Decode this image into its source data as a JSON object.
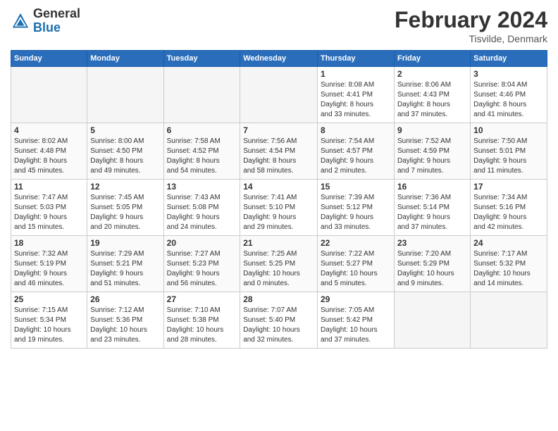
{
  "header": {
    "logo_general": "General",
    "logo_blue": "Blue",
    "month_title": "February 2024",
    "location": "Tisvilde, Denmark"
  },
  "weekdays": [
    "Sunday",
    "Monday",
    "Tuesday",
    "Wednesday",
    "Thursday",
    "Friday",
    "Saturday"
  ],
  "weeks": [
    {
      "days": [
        {
          "num": "",
          "info": ""
        },
        {
          "num": "",
          "info": ""
        },
        {
          "num": "",
          "info": ""
        },
        {
          "num": "",
          "info": ""
        },
        {
          "num": "1",
          "info": "Sunrise: 8:08 AM\nSunset: 4:41 PM\nDaylight: 8 hours\nand 33 minutes."
        },
        {
          "num": "2",
          "info": "Sunrise: 8:06 AM\nSunset: 4:43 PM\nDaylight: 8 hours\nand 37 minutes."
        },
        {
          "num": "3",
          "info": "Sunrise: 8:04 AM\nSunset: 4:46 PM\nDaylight: 8 hours\nand 41 minutes."
        }
      ]
    },
    {
      "days": [
        {
          "num": "4",
          "info": "Sunrise: 8:02 AM\nSunset: 4:48 PM\nDaylight: 8 hours\nand 45 minutes."
        },
        {
          "num": "5",
          "info": "Sunrise: 8:00 AM\nSunset: 4:50 PM\nDaylight: 8 hours\nand 49 minutes."
        },
        {
          "num": "6",
          "info": "Sunrise: 7:58 AM\nSunset: 4:52 PM\nDaylight: 8 hours\nand 54 minutes."
        },
        {
          "num": "7",
          "info": "Sunrise: 7:56 AM\nSunset: 4:54 PM\nDaylight: 8 hours\nand 58 minutes."
        },
        {
          "num": "8",
          "info": "Sunrise: 7:54 AM\nSunset: 4:57 PM\nDaylight: 9 hours\nand 2 minutes."
        },
        {
          "num": "9",
          "info": "Sunrise: 7:52 AM\nSunset: 4:59 PM\nDaylight: 9 hours\nand 7 minutes."
        },
        {
          "num": "10",
          "info": "Sunrise: 7:50 AM\nSunset: 5:01 PM\nDaylight: 9 hours\nand 11 minutes."
        }
      ]
    },
    {
      "days": [
        {
          "num": "11",
          "info": "Sunrise: 7:47 AM\nSunset: 5:03 PM\nDaylight: 9 hours\nand 15 minutes."
        },
        {
          "num": "12",
          "info": "Sunrise: 7:45 AM\nSunset: 5:05 PM\nDaylight: 9 hours\nand 20 minutes."
        },
        {
          "num": "13",
          "info": "Sunrise: 7:43 AM\nSunset: 5:08 PM\nDaylight: 9 hours\nand 24 minutes."
        },
        {
          "num": "14",
          "info": "Sunrise: 7:41 AM\nSunset: 5:10 PM\nDaylight: 9 hours\nand 29 minutes."
        },
        {
          "num": "15",
          "info": "Sunrise: 7:39 AM\nSunset: 5:12 PM\nDaylight: 9 hours\nand 33 minutes."
        },
        {
          "num": "16",
          "info": "Sunrise: 7:36 AM\nSunset: 5:14 PM\nDaylight: 9 hours\nand 37 minutes."
        },
        {
          "num": "17",
          "info": "Sunrise: 7:34 AM\nSunset: 5:16 PM\nDaylight: 9 hours\nand 42 minutes."
        }
      ]
    },
    {
      "days": [
        {
          "num": "18",
          "info": "Sunrise: 7:32 AM\nSunset: 5:19 PM\nDaylight: 9 hours\nand 46 minutes."
        },
        {
          "num": "19",
          "info": "Sunrise: 7:29 AM\nSunset: 5:21 PM\nDaylight: 9 hours\nand 51 minutes."
        },
        {
          "num": "20",
          "info": "Sunrise: 7:27 AM\nSunset: 5:23 PM\nDaylight: 9 hours\nand 56 minutes."
        },
        {
          "num": "21",
          "info": "Sunrise: 7:25 AM\nSunset: 5:25 PM\nDaylight: 10 hours\nand 0 minutes."
        },
        {
          "num": "22",
          "info": "Sunrise: 7:22 AM\nSunset: 5:27 PM\nDaylight: 10 hours\nand 5 minutes."
        },
        {
          "num": "23",
          "info": "Sunrise: 7:20 AM\nSunset: 5:29 PM\nDaylight: 10 hours\nand 9 minutes."
        },
        {
          "num": "24",
          "info": "Sunrise: 7:17 AM\nSunset: 5:32 PM\nDaylight: 10 hours\nand 14 minutes."
        }
      ]
    },
    {
      "days": [
        {
          "num": "25",
          "info": "Sunrise: 7:15 AM\nSunset: 5:34 PM\nDaylight: 10 hours\nand 19 minutes."
        },
        {
          "num": "26",
          "info": "Sunrise: 7:12 AM\nSunset: 5:36 PM\nDaylight: 10 hours\nand 23 minutes."
        },
        {
          "num": "27",
          "info": "Sunrise: 7:10 AM\nSunset: 5:38 PM\nDaylight: 10 hours\nand 28 minutes."
        },
        {
          "num": "28",
          "info": "Sunrise: 7:07 AM\nSunset: 5:40 PM\nDaylight: 10 hours\nand 32 minutes."
        },
        {
          "num": "29",
          "info": "Sunrise: 7:05 AM\nSunset: 5:42 PM\nDaylight: 10 hours\nand 37 minutes."
        },
        {
          "num": "",
          "info": ""
        },
        {
          "num": "",
          "info": ""
        }
      ]
    }
  ]
}
